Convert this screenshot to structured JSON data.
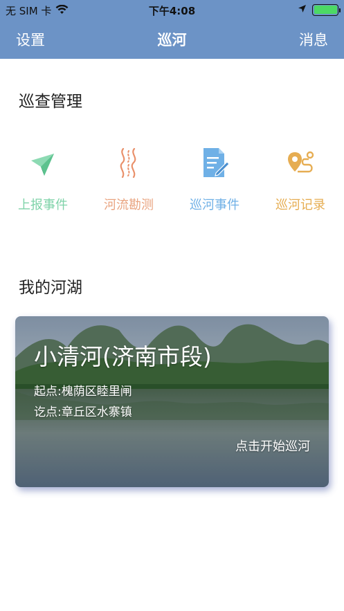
{
  "status_bar": {
    "carrier": "无 SIM 卡",
    "time": "下午4:08",
    "battery_level": 1.0,
    "icons": [
      "wifi-icon",
      "location-arrow-icon",
      "battery-icon"
    ]
  },
  "nav": {
    "left": "设置",
    "title": "巡河",
    "right": "消息"
  },
  "patrol": {
    "title": "巡查管理",
    "items": [
      {
        "label": "上报事件",
        "icon": "paper-plane-icon",
        "color": "#7fd3a9"
      },
      {
        "label": "河流勘测",
        "icon": "river-icon",
        "color": "#e9a37f"
      },
      {
        "label": "巡河事件",
        "icon": "document-edit-icon",
        "color": "#6fb0e6"
      },
      {
        "label": "巡河记录",
        "icon": "route-pin-icon",
        "color": "#e6ad52"
      }
    ]
  },
  "rivers": {
    "title": "我的河湖",
    "cards": [
      {
        "name": "小清河(济南市段)",
        "start": "起点:槐荫区睦里闸",
        "end": "讫点:章丘区水寨镇",
        "action": "点击开始巡河"
      }
    ]
  },
  "colors": {
    "nav_bar": "#6c93c6",
    "card_shadow": "#3c50a0"
  }
}
